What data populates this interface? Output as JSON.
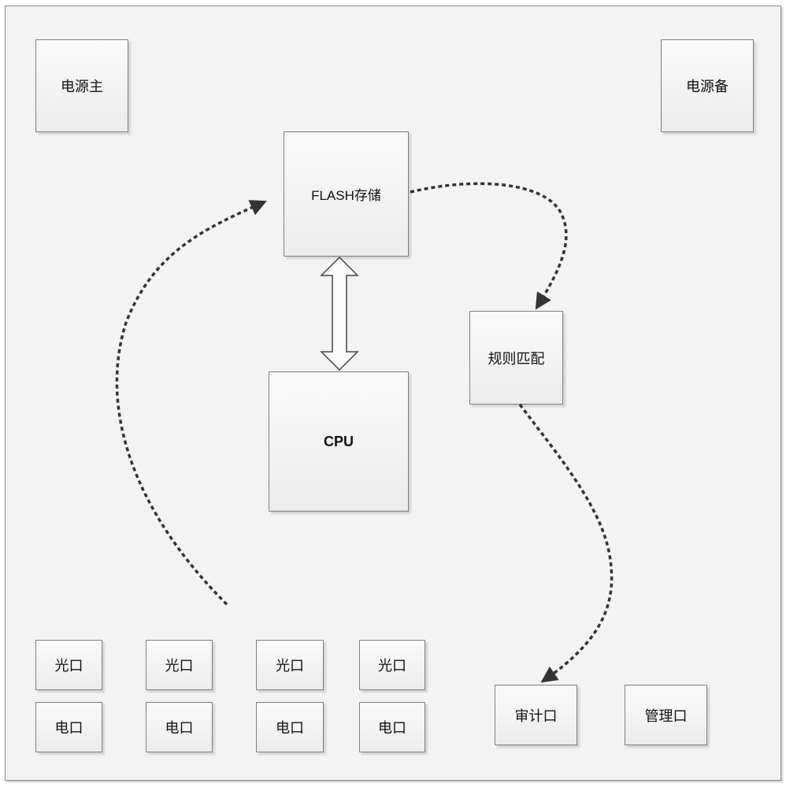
{
  "diagram": {
    "power_main": "电源主",
    "power_backup": "电源备",
    "flash": "FLASH存储",
    "cpu": "CPU",
    "rule_match": "规则匹配",
    "optical_ports": [
      "光口",
      "光口",
      "光口",
      "光口"
    ],
    "electrical_ports": [
      "电口",
      "电口",
      "电口",
      "电口"
    ],
    "audit_port": "审计口",
    "management_port": "管理口",
    "connections": [
      {
        "from": "ports",
        "to": "flash",
        "style": "dashed-arrow"
      },
      {
        "from": "flash",
        "to": "rule_match",
        "style": "dashed-arrow"
      },
      {
        "from": "rule_match",
        "to": "audit_port",
        "style": "dashed-arrow"
      },
      {
        "from": "flash",
        "to": "cpu",
        "style": "double-headed-block-arrow"
      }
    ],
    "colors": {
      "box_border": "#7f7f7f",
      "arrow": "#333333",
      "background": "#f3f3f3"
    }
  }
}
